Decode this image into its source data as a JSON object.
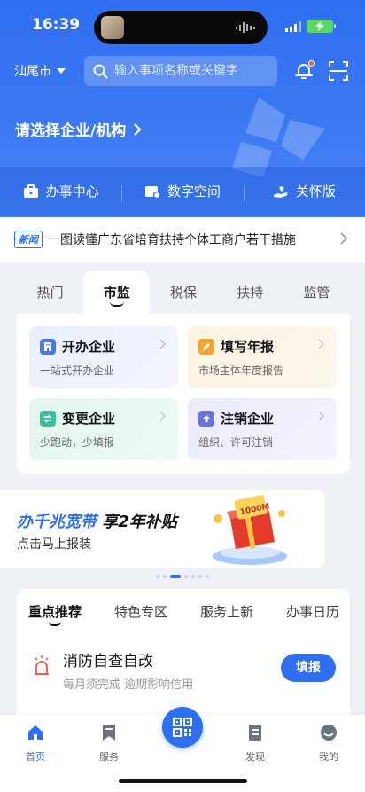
{
  "status_bar": {
    "time": "16:39"
  },
  "header": {
    "city": "汕尾市",
    "search_placeholder": "输入事项名称或关键字",
    "org_prompt": "请选择企业/机构"
  },
  "service_bar": [
    {
      "label": "办事中心",
      "icon": "briefcase-icon"
    },
    {
      "label": "数字空间",
      "icon": "digital-space-icon"
    },
    {
      "label": "关怀版",
      "icon": "care-hand-icon"
    }
  ],
  "news": {
    "tag": "新闻",
    "text": "一图读懂广东省培育扶持个体工商户若干措施"
  },
  "category_tabs": [
    {
      "label": "热门",
      "active": false
    },
    {
      "label": "市监",
      "active": true
    },
    {
      "label": "税保",
      "active": false
    },
    {
      "label": "扶持",
      "active": false
    },
    {
      "label": "监管",
      "active": false
    }
  ],
  "category_cards": [
    {
      "title": "开办企业",
      "subtitle": "一站式开办企业",
      "icon": "building-icon",
      "color": "#4a7ae8"
    },
    {
      "title": "填写年报",
      "subtitle": "市场主体年度报告",
      "icon": "pencil-icon",
      "color": "#f0a632"
    },
    {
      "title": "变更企业",
      "subtitle": "少跑动，少填报",
      "icon": "change-icon",
      "color": "#3cbf9c"
    },
    {
      "title": "注销企业",
      "subtitle": "组织、许可注销",
      "icon": "upload-icon",
      "color": "#6b72d9"
    }
  ],
  "banner": {
    "highlight": "办千兆宽带",
    "main": "享2年补贴",
    "sub": "点击马上报装",
    "gift_label": "1000M"
  },
  "recommend_tabs": [
    {
      "label": "重点推荐",
      "active": true
    },
    {
      "label": "特色专区",
      "active": false
    },
    {
      "label": "服务上新",
      "active": false
    },
    {
      "label": "办事日历",
      "active": false
    }
  ],
  "recommend_item": {
    "title": "消防自查自改",
    "subtitle": "每月须完成 逾期影响信用",
    "button": "填报"
  },
  "bottom_nav": [
    {
      "label": "首页",
      "active": true,
      "icon": "home-icon"
    },
    {
      "label": "服务",
      "active": false,
      "icon": "bookmark-icon"
    },
    {
      "label": "发现",
      "active": false,
      "icon": "discover-icon"
    },
    {
      "label": "我的",
      "active": false,
      "icon": "profile-icon"
    }
  ],
  "colors": {
    "primary": "#2f6ef0",
    "hero_top": "#2f6ef0",
    "hero_bottom": "#4c86f5",
    "alert": "#ff4d4f"
  }
}
